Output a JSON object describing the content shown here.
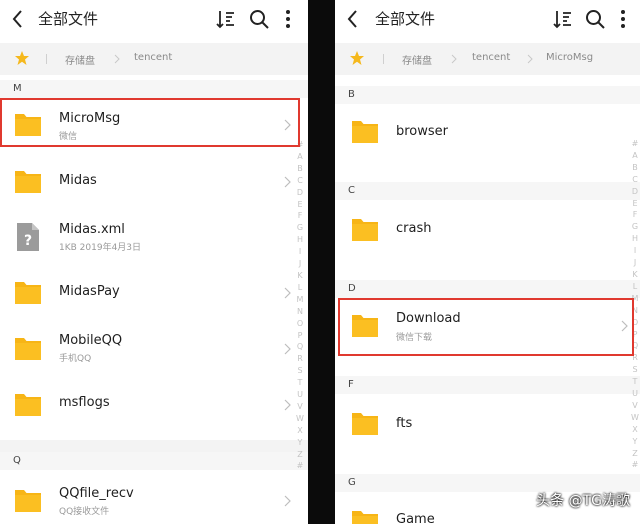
{
  "left": {
    "title": "全部文件",
    "breadcrumb": [
      "存储盘",
      "tencent"
    ],
    "sections": [
      {
        "label": "M",
        "items": [
          {
            "name": "MicroMsg",
            "sub": "微信",
            "icon": "folder-icon"
          },
          {
            "name": "Midas",
            "sub": "",
            "icon": "folder-icon"
          },
          {
            "name": "Midas.xml",
            "sub": "1KB  2019年4月3日",
            "icon": "unknown-file-icon"
          },
          {
            "name": "MidasPay",
            "sub": "",
            "icon": "folder-icon"
          },
          {
            "name": "MobileQQ",
            "sub": "手机QQ",
            "icon": "folder-icon"
          },
          {
            "name": "msflogs",
            "sub": "",
            "icon": "folder-icon"
          }
        ]
      },
      {
        "label": "Q",
        "items": [
          {
            "name": "QQfile_recv",
            "sub": "QQ接收文件",
            "icon": "folder-icon"
          }
        ]
      }
    ]
  },
  "right": {
    "title": "全部文件",
    "breadcrumb": [
      "存储盘",
      "tencent",
      "MicroMsg"
    ],
    "sections": [
      {
        "label": "B",
        "items": [
          {
            "name": "browser",
            "sub": "",
            "icon": "folder-icon"
          }
        ]
      },
      {
        "label": "C",
        "items": [
          {
            "name": "crash",
            "sub": "",
            "icon": "folder-icon"
          }
        ]
      },
      {
        "label": "D",
        "items": [
          {
            "name": "Download",
            "sub": "微信下载",
            "icon": "folder-icon"
          }
        ]
      },
      {
        "label": "F",
        "items": [
          {
            "name": "fts",
            "sub": "",
            "icon": "folder-icon"
          }
        ]
      },
      {
        "label": "G",
        "items": [
          {
            "name": "Game",
            "sub": "",
            "icon": "folder-icon"
          }
        ]
      }
    ]
  },
  "alphabet": [
    "#",
    "A",
    "B",
    "C",
    "D",
    "E",
    "F",
    "G",
    "H",
    "I",
    "J",
    "K",
    "L",
    "M",
    "N",
    "O",
    "P",
    "Q",
    "R",
    "S",
    "T",
    "U",
    "V",
    "W",
    "X",
    "Y",
    "Z",
    "#"
  ],
  "watermark": "头条 @TG涛歌",
  "colors": {
    "folder": "#f7b516",
    "accent_star": "#f5b81c",
    "highlight": "#e0392f"
  }
}
